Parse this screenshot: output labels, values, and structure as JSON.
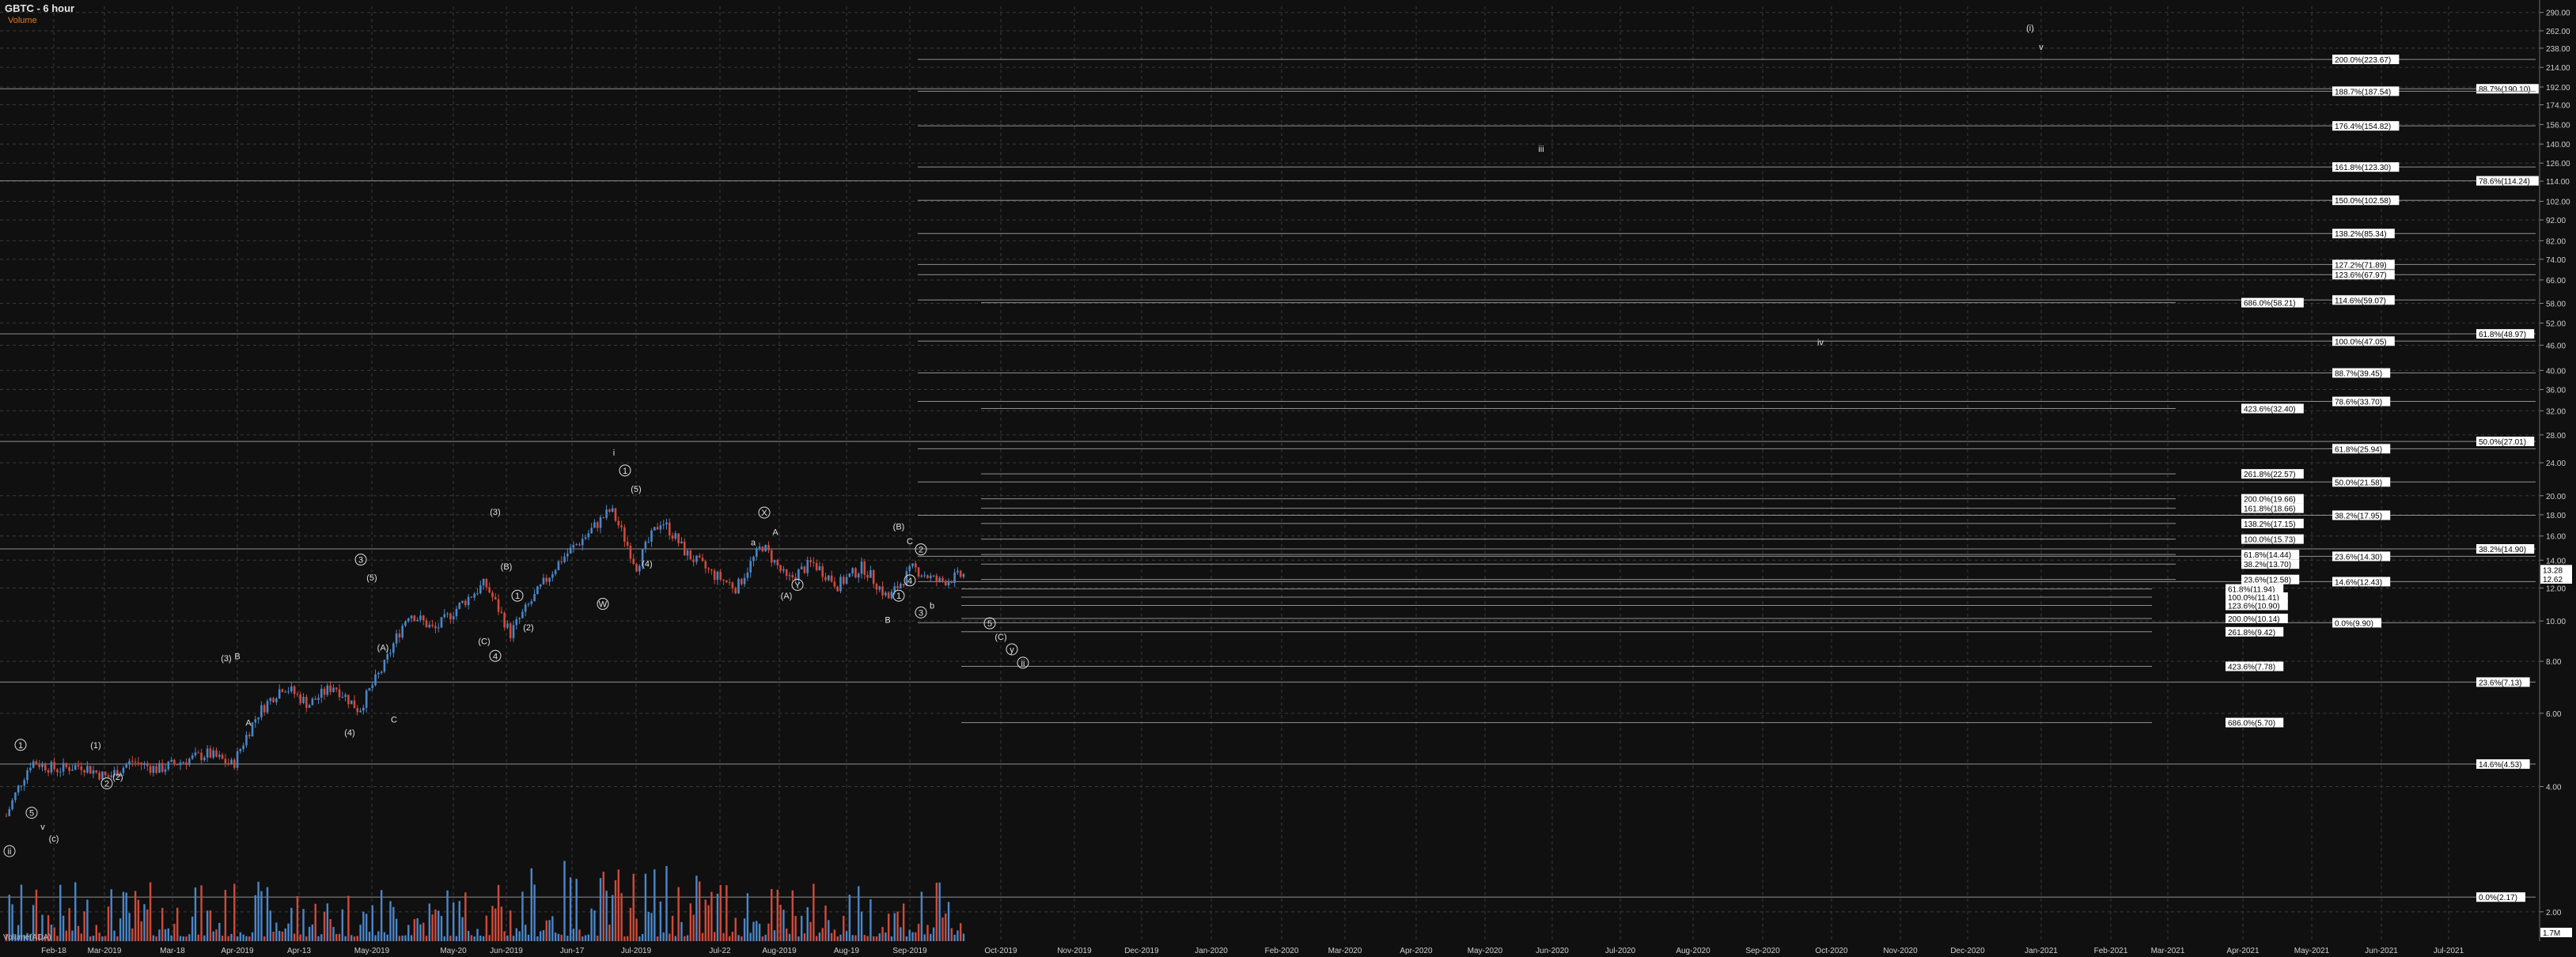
{
  "header": {
    "title": "GBTC - 6 hour",
    "subtitle": "Volume"
  },
  "volume_label": "Volume(ADA)",
  "colors": {
    "background": "#101010",
    "grid": "#3a3a3a",
    "up_candle": "#4a86c8",
    "down_candle": "#d04a3a",
    "fib_line": "#8f8f8f",
    "text": "#e0e0e0",
    "label_box": "#ffffff"
  },
  "chart_data": {
    "type": "candlestick",
    "y_scale": "log",
    "ylim": [
      1.7,
      300
    ],
    "y_ticks": [
      "290.00",
      "262.00",
      "238.00",
      "214.00",
      "192.00",
      "174.00",
      "156.00",
      "140.00",
      "126.00",
      "114.00",
      "102.00",
      "92.00",
      "82.00",
      "74.00",
      "66.00",
      "58.00",
      "52.00",
      "46.00",
      "40.00",
      "36.00",
      "32.00",
      "28.00",
      "24.00",
      "20.00",
      "18.00",
      "16.00",
      "14.00",
      "12.00",
      "10.00",
      "8.00",
      "6.00",
      "4.00",
      "2.00"
    ],
    "last_price_labels": [
      "13.28",
      "12.62"
    ],
    "bottom_value_label": "1.7M",
    "x_ticks": [
      "Feb-18",
      "Mar-2019",
      "Mar-18",
      "Apr-2019",
      "Apr-13",
      "May-2019",
      "May-20",
      "Jun-2019",
      "Jun-17",
      "Jul-2019",
      "Jul-22",
      "Aug-2019",
      "Aug-19",
      "Sep-2019",
      "Oct-2019",
      "Nov-2019",
      "Dec-2019",
      "Jan-2020",
      "Feb-2020",
      "Mar-2020",
      "Apr-2020",
      "May-2020",
      "Jun-2020",
      "Jul-2020",
      "Aug-2020",
      "Sep-2020",
      "Oct-2020",
      "Nov-2020",
      "Dec-2020",
      "Jan-2021",
      "Feb-2021",
      "Mar-2021",
      "Apr-2021",
      "May-2021",
      "Jun-2021",
      "Jul-2021"
    ],
    "price_path": [
      {
        "date": "Feb-2019",
        "price": 3.4
      },
      {
        "date": "Feb-2019",
        "price": 4.6
      },
      {
        "date": "Feb-2019",
        "price": 4.4
      },
      {
        "date": "Mar-2019",
        "price": 4.5
      },
      {
        "date": "Mar-2019",
        "price": 4.2
      },
      {
        "date": "Mar-2019",
        "price": 4.6
      },
      {
        "date": "Mar-2019",
        "price": 4.4
      },
      {
        "date": "Mar-2019",
        "price": 4.6
      },
      {
        "date": "Mar-2019",
        "price": 4.8
      },
      {
        "date": "Apr-2019",
        "price": 4.5
      },
      {
        "date": "Apr-2019",
        "price": 6.0
      },
      {
        "date": "Apr-2019",
        "price": 7.0
      },
      {
        "date": "Apr-2019",
        "price": 6.3
      },
      {
        "date": "Apr-2019",
        "price": 7.0
      },
      {
        "date": "May-2019",
        "price": 6.1
      },
      {
        "date": "May-2019",
        "price": 7.8
      },
      {
        "date": "May-2019",
        "price": 10.5
      },
      {
        "date": "May-2019",
        "price": 9.5
      },
      {
        "date": "May-2019",
        "price": 10.9
      },
      {
        "date": "Jun-2019",
        "price": 12.3
      },
      {
        "date": "Jun-2019",
        "price": 9.3
      },
      {
        "date": "Jun-2019",
        "price": 11.5
      },
      {
        "date": "Jun-2019",
        "price": 14.0
      },
      {
        "date": "Jun-2019",
        "price": 16.0
      },
      {
        "date": "Jul-2019",
        "price": 18.5
      },
      {
        "date": "Jul-2019",
        "price": 13.5
      },
      {
        "date": "Jul-2019",
        "price": 17.5
      },
      {
        "date": "Jul-2019",
        "price": 14.5
      },
      {
        "date": "Jul-2019",
        "price": 13.0
      },
      {
        "date": "Jul-2019",
        "price": 12.0
      },
      {
        "date": "Aug-2019",
        "price": 15.2
      },
      {
        "date": "Aug-2019",
        "price": 12.5
      },
      {
        "date": "Aug-2019",
        "price": 13.8
      },
      {
        "date": "Aug-2019",
        "price": 12.2
      },
      {
        "date": "Aug-2019",
        "price": 13.5
      },
      {
        "date": "Sep-2019",
        "price": 11.3
      },
      {
        "date": "Sep-2019",
        "price": 13.4
      },
      {
        "date": "Sep-2019",
        "price": 12.4
      },
      {
        "date": "Sep-2019",
        "price": 12.9
      }
    ],
    "horizontal_levels": [
      {
        "label": "88.7%(190.10)",
        "value": 190.1,
        "group": "far"
      },
      {
        "label": "78.6%(114.24)",
        "value": 114.24,
        "group": "far"
      },
      {
        "label": "61.8%(48.97)",
        "value": 48.97,
        "group": "far"
      },
      {
        "label": "50.0%(27.01)",
        "value": 27.01,
        "group": "far"
      },
      {
        "label": "38.2%(14.90)",
        "value": 14.9,
        "group": "far"
      },
      {
        "label": "23.6%(7.13)",
        "value": 7.13,
        "group": "far"
      },
      {
        "label": "14.6%(4.53)",
        "value": 4.53,
        "group": "far"
      },
      {
        "label": "0.0%(2.17)",
        "value": 2.17,
        "group": "far"
      },
      {
        "label": "200.0%(223.67)",
        "value": 223.67,
        "group": "mid"
      },
      {
        "label": "188.7%(187.54)",
        "value": 187.54,
        "group": "mid"
      },
      {
        "label": "176.4%(154.82)",
        "value": 154.82,
        "group": "mid"
      },
      {
        "label": "161.8%(123.30)",
        "value": 123.3,
        "group": "mid"
      },
      {
        "label": "150.0%(102.58)",
        "value": 102.58,
        "group": "mid"
      },
      {
        "label": "138.2%(85.34)",
        "value": 85.34,
        "group": "mid"
      },
      {
        "label": "127.2%(71.89)",
        "value": 71.89,
        "group": "mid"
      },
      {
        "label": "123.6%(67.97)",
        "value": 67.97,
        "group": "mid"
      },
      {
        "label": "114.6%(59.07)",
        "value": 59.07,
        "group": "mid"
      },
      {
        "label": "100.0%(47.05)",
        "value": 47.05,
        "group": "mid"
      },
      {
        "label": "88.7%(39.45)",
        "value": 39.45,
        "group": "mid"
      },
      {
        "label": "78.6%(33.70)",
        "value": 33.7,
        "group": "mid"
      },
      {
        "label": "61.8%(25.94)",
        "value": 25.94,
        "group": "mid"
      },
      {
        "label": "50.0%(21.58)",
        "value": 21.58,
        "group": "mid"
      },
      {
        "label": "38.2%(17.95)",
        "value": 17.95,
        "group": "mid"
      },
      {
        "label": "23.6%(14.30)",
        "value": 14.3,
        "group": "mid"
      },
      {
        "label": "14.6%(12.43)",
        "value": 12.43,
        "group": "mid"
      },
      {
        "label": "0.0%(9.90)",
        "value": 9.9,
        "group": "mid"
      },
      {
        "label": "686.0%(58.21)",
        "value": 58.21,
        "group": "near"
      },
      {
        "label": "423.6%(32.40)",
        "value": 32.4,
        "group": "near"
      },
      {
        "label": "261.8%(22.57)",
        "value": 22.57,
        "group": "near"
      },
      {
        "label": "200.0%(19.66)",
        "value": 19.66,
        "group": "near"
      },
      {
        "label": "161.8%(18.66)",
        "value": 18.66,
        "group": "near"
      },
      {
        "label": "138.2%(17.15)",
        "value": 17.15,
        "group": "near"
      },
      {
        "label": "100.0%(15.73)",
        "value": 15.73,
        "group": "near"
      },
      {
        "label": "61.8%(14.44)",
        "value": 14.44,
        "group": "near"
      },
      {
        "label": "38.2%(13.70)",
        "value": 13.7,
        "group": "near"
      },
      {
        "label": "23.6%(12.58)",
        "value": 12.58,
        "group": "near"
      },
      {
        "label": "61.8%(11.94)",
        "value": 11.94,
        "group": "low"
      },
      {
        "label": "100.0%(11.41)",
        "value": 11.41,
        "group": "low"
      },
      {
        "label": "123.6%(10.90)",
        "value": 10.9,
        "group": "low"
      },
      {
        "label": "200.0%(10.14)",
        "value": 10.14,
        "group": "low"
      },
      {
        "label": "261.8%(9.42)",
        "value": 9.42,
        "group": "low"
      },
      {
        "label": "423.6%(7.78)",
        "value": 7.78,
        "group": "low"
      },
      {
        "label": "686.0%(5.70)",
        "value": 5.7,
        "group": "low"
      }
    ],
    "wave_labels": [
      {
        "text": "(i)",
        "date": "Jan-2021",
        "price": 262
      },
      {
        "text": "v",
        "date": "Jan-2021",
        "price": 236
      },
      {
        "text": "iii",
        "date": "Jun-2020",
        "price": 134
      },
      {
        "text": "iv",
        "date": "Oct-2020",
        "price": 46
      },
      {
        "text": "i",
        "date": "Jul-2019",
        "price": 25
      },
      {
        "text": "1",
        "date": "Jul-2019",
        "price": 22.6
      },
      {
        "text": "(5)",
        "date": "Jul-2019",
        "price": 20.4
      },
      {
        "text": "(3)",
        "date": "Jun-2019",
        "price": 18.0
      },
      {
        "text": "(4)",
        "date": "Jul-2019",
        "price": 13.5
      },
      {
        "text": "X",
        "date": "Aug-2019",
        "price": 17.9
      },
      {
        "text": "W",
        "date": "Jul-2019",
        "price": 10.8
      },
      {
        "text": "A",
        "date": "Aug-2019",
        "price": 16.1
      },
      {
        "text": "(A)",
        "date": "Aug-2019",
        "price": 11.3
      },
      {
        "text": "Y",
        "date": "Aug-2019",
        "price": 12.0
      },
      {
        "text": "a",
        "date": "Aug-2019",
        "price": 15.2
      },
      {
        "text": "(B)",
        "date": "Sep-2019",
        "price": 16.6
      },
      {
        "text": "C",
        "date": "Sep-2019",
        "price": 15.3
      },
      {
        "text": "2",
        "date": "Sep-2019",
        "price": 14.6
      },
      {
        "text": "b",
        "date": "Sep-2019",
        "price": 10.7
      },
      {
        "text": "B",
        "date": "Sep-2019",
        "price": 9.9
      },
      {
        "text": "1",
        "date": "Sep-2019",
        "price": 11.3
      },
      {
        "text": "4",
        "date": "Sep-2019",
        "price": 12.3
      },
      {
        "text": "3",
        "date": "Sep-2019",
        "price": 10.3
      },
      {
        "text": "5",
        "date": "Oct-2019",
        "price": 9.7
      },
      {
        "text": "(C)",
        "date": "Oct-2019",
        "price": 9.0
      },
      {
        "text": "y",
        "date": "Oct-2019",
        "price": 8.4
      },
      {
        "text": "ii",
        "date": "Oct-2019",
        "price": 7.8
      },
      {
        "text": "3",
        "date": "May-2019",
        "price": 13.8
      },
      {
        "text": "(5)",
        "date": "May-2019",
        "price": 12.5
      },
      {
        "text": "(A)",
        "date": "May-2019",
        "price": 8.5
      },
      {
        "text": "(B)",
        "date": "Jun-2019",
        "price": 13.3
      },
      {
        "text": "1",
        "date": "Jun-2019",
        "price": 11.3
      },
      {
        "text": "(2)",
        "date": "Jun-2019",
        "price": 9.5
      },
      {
        "text": "(C)",
        "date": "Jun-2019",
        "price": 8.8
      },
      {
        "text": "4",
        "date": "Jun-2019",
        "price": 8.1
      },
      {
        "text": "(3)",
        "date": "Apr-2019",
        "price": 8.0
      },
      {
        "text": "B",
        "date": "Apr-2019",
        "price": 8.1
      },
      {
        "text": "A",
        "date": "Apr-2019",
        "price": 5.6
      },
      {
        "text": "C",
        "date": "May-2019",
        "price": 5.7
      },
      {
        "text": "(4)",
        "date": "May-2019",
        "price": 5.3
      },
      {
        "text": "1",
        "date": "Feb-2019",
        "price": 4.95
      },
      {
        "text": "(1)",
        "date": "Mar-2019",
        "price": 4.95
      },
      {
        "text": "2",
        "date": "Mar-2019",
        "price": 4.0
      },
      {
        "text": "(2)",
        "date": "Mar-2019",
        "price": 4.15
      },
      {
        "text": "5",
        "date": "Feb-2019",
        "price": 3.4
      },
      {
        "text": "v",
        "date": "Feb-2019",
        "price": 3.15
      },
      {
        "text": "(c)",
        "date": "Feb-2019",
        "price": 2.95
      },
      {
        "text": "ii",
        "date": "Feb-2019",
        "price": 2.75
      }
    ]
  }
}
